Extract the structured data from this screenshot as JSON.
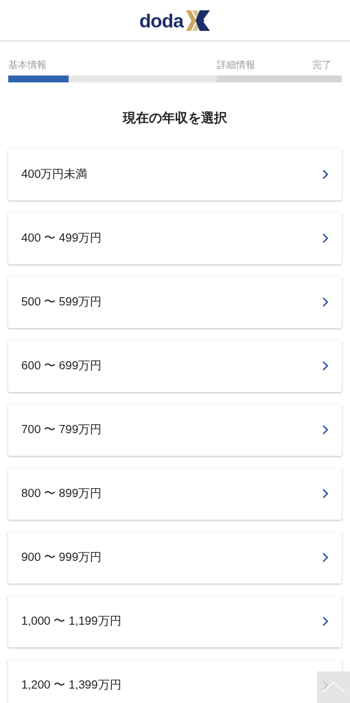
{
  "header": {
    "logo_text": "doda"
  },
  "progress": {
    "steps": [
      {
        "label": "基本情報",
        "selected": true,
        "level": 0.29
      },
      {
        "label": "詳細情報",
        "selected": false
      },
      {
        "label": "完了",
        "selected": false
      }
    ]
  },
  "title": "現在の年収を選択",
  "options": [
    {
      "label": "400万円未満"
    },
    {
      "label": "400 〜 499万円"
    },
    {
      "label": "500 〜 599万円"
    },
    {
      "label": "600 〜 699万円"
    },
    {
      "label": "700 〜 799万円"
    },
    {
      "label": "800 〜 899万円"
    },
    {
      "label": "900 〜 999万円"
    },
    {
      "label": "1,000 〜 1,199万円"
    },
    {
      "label": "1,200 〜 1,399万円"
    }
  ]
}
